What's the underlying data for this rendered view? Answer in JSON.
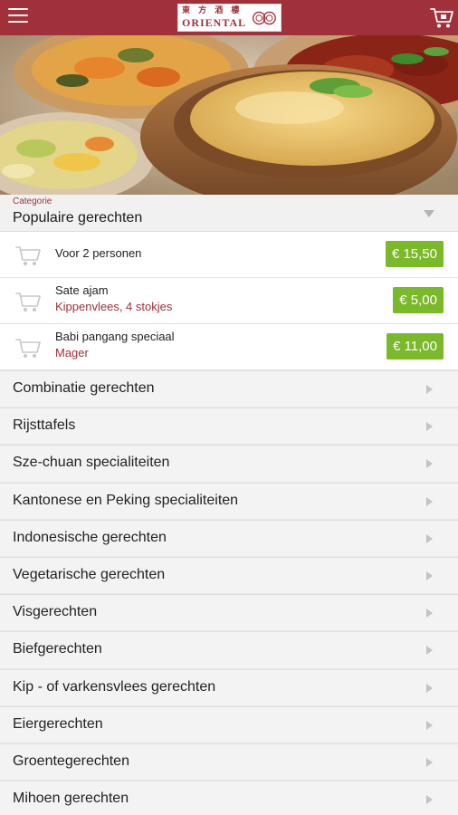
{
  "header": {
    "logo_chinese": "東 方 酒 樓",
    "logo_name": "ORIENTAL"
  },
  "category_selector": {
    "label": "Categorie",
    "value": "Populaire gerechten"
  },
  "items": [
    {
      "name": "Voor 2 personen",
      "subtitle": "",
      "price": "€ 15,50"
    },
    {
      "name": "Sate ajam",
      "subtitle": "Kippenvlees, 4 stokjes",
      "price": "€ 5,00"
    },
    {
      "name": "Babi pangang speciaal",
      "subtitle": "Mager",
      "price": "€ 11,00"
    }
  ],
  "categories": [
    "Combinatie gerechten",
    "Rijsttafels",
    "Sze-chuan specialiteiten",
    "Kantonese en Peking specialiteiten",
    "Indonesische gerechten",
    "Vegetarische gerechten",
    "Visgerechten",
    "Biefgerechten",
    "Kip - of varkensvlees gerechten",
    "Eiergerechten",
    "Groentegerechten",
    "Mihoen gerechten"
  ],
  "colors": {
    "brand": "#a0303a",
    "price_badge": "#7ab929"
  },
  "icons": {
    "menu": "hamburger-icon",
    "cart": "shopping-cart-icon",
    "category_dropdown": "triangle-down-icon",
    "category_row": "chevron-right-icon"
  }
}
